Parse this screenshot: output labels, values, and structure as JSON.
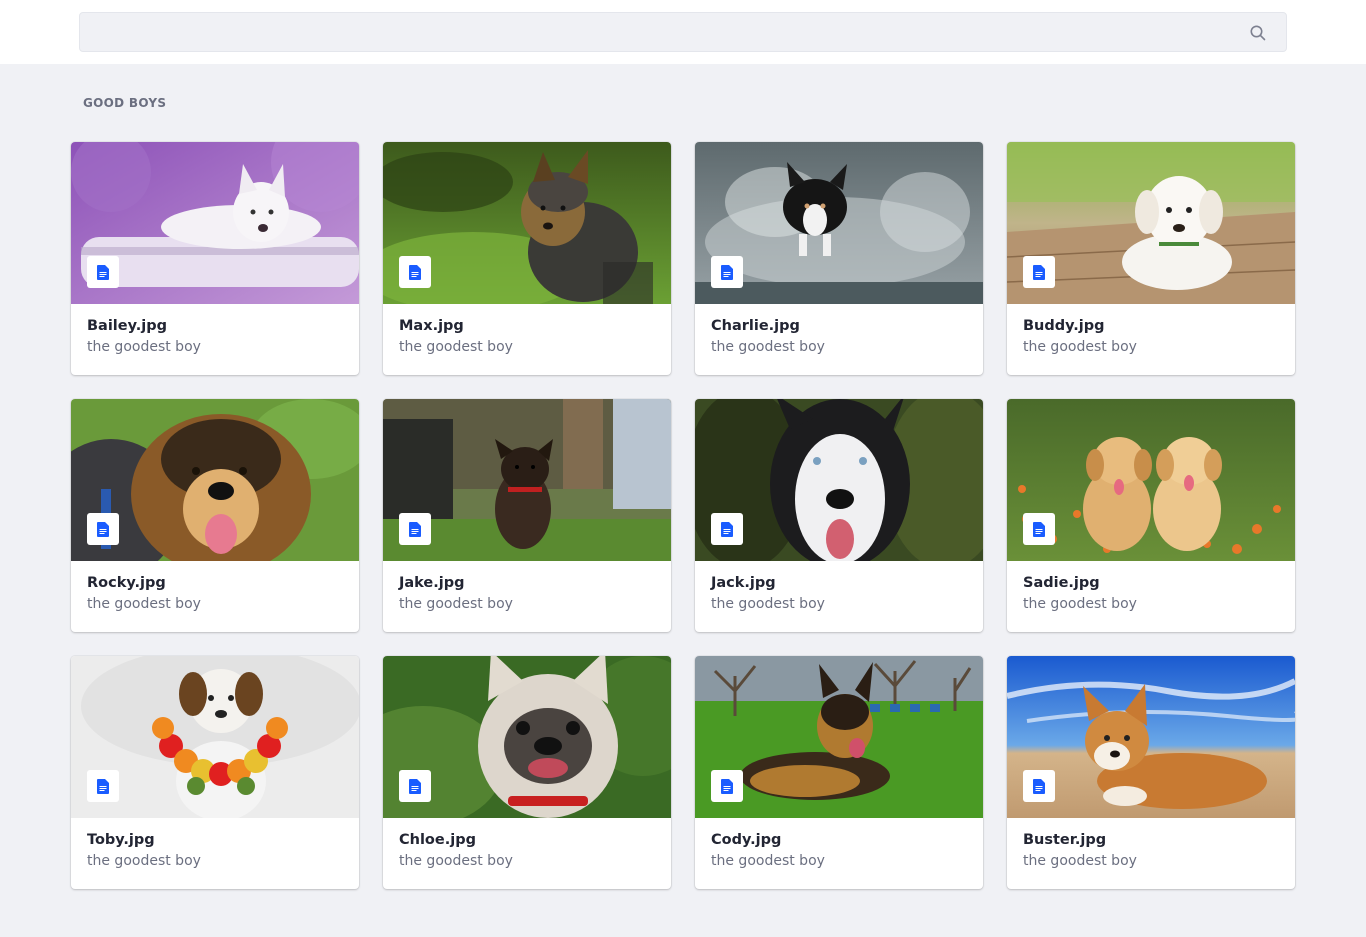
{
  "search": {
    "placeholder": "",
    "value": ""
  },
  "section": {
    "title": "GOOD BOYS"
  },
  "files": [
    {
      "name": "Bailey.jpg",
      "subtitle": "the goodest boy",
      "photo": "white dog resting on birch log, purple background"
    },
    {
      "name": "Max.jpg",
      "subtitle": "the goodest boy",
      "photo": "yorkshire terrier on green grass"
    },
    {
      "name": "Charlie.jpg",
      "subtitle": "the goodest boy",
      "photo": "black and white dog splashing through water"
    },
    {
      "name": "Buddy.jpg",
      "subtitle": "the goodest boy",
      "photo": "white puppy lying on wooden deck"
    },
    {
      "name": "Rocky.jpg",
      "subtitle": "the goodest boy",
      "photo": "smiling shepherd mix on grass"
    },
    {
      "name": "Jake.jpg",
      "subtitle": "the goodest boy",
      "photo": "dark puppy with red collar walking"
    },
    {
      "name": "Jack.jpg",
      "subtitle": "the goodest boy",
      "photo": "husky face close-up"
    },
    {
      "name": "Sadie.jpg",
      "subtitle": "the goodest boy",
      "photo": "two golden retriever puppies among orange flowers"
    },
    {
      "name": "Toby.jpg",
      "subtitle": "the goodest boy",
      "photo": "dog wearing flower garland on white background"
    },
    {
      "name": "Chloe.jpg",
      "subtitle": "the goodest boy",
      "photo": "french bulldog with red collar"
    },
    {
      "name": "Cody.jpg",
      "subtitle": "the goodest boy",
      "photo": "german shepherd lying on grass"
    },
    {
      "name": "Buster.jpg",
      "subtitle": "the goodest boy",
      "photo": "corgi lying on sand under blue sky"
    }
  ],
  "icons": {
    "search": "search-icon",
    "file": "document-icon"
  },
  "colors": {
    "accent": "#1a5cff",
    "page_bg": "#f0f1f5",
    "text_muted": "#6b6f80",
    "text_dark": "#222533"
  }
}
